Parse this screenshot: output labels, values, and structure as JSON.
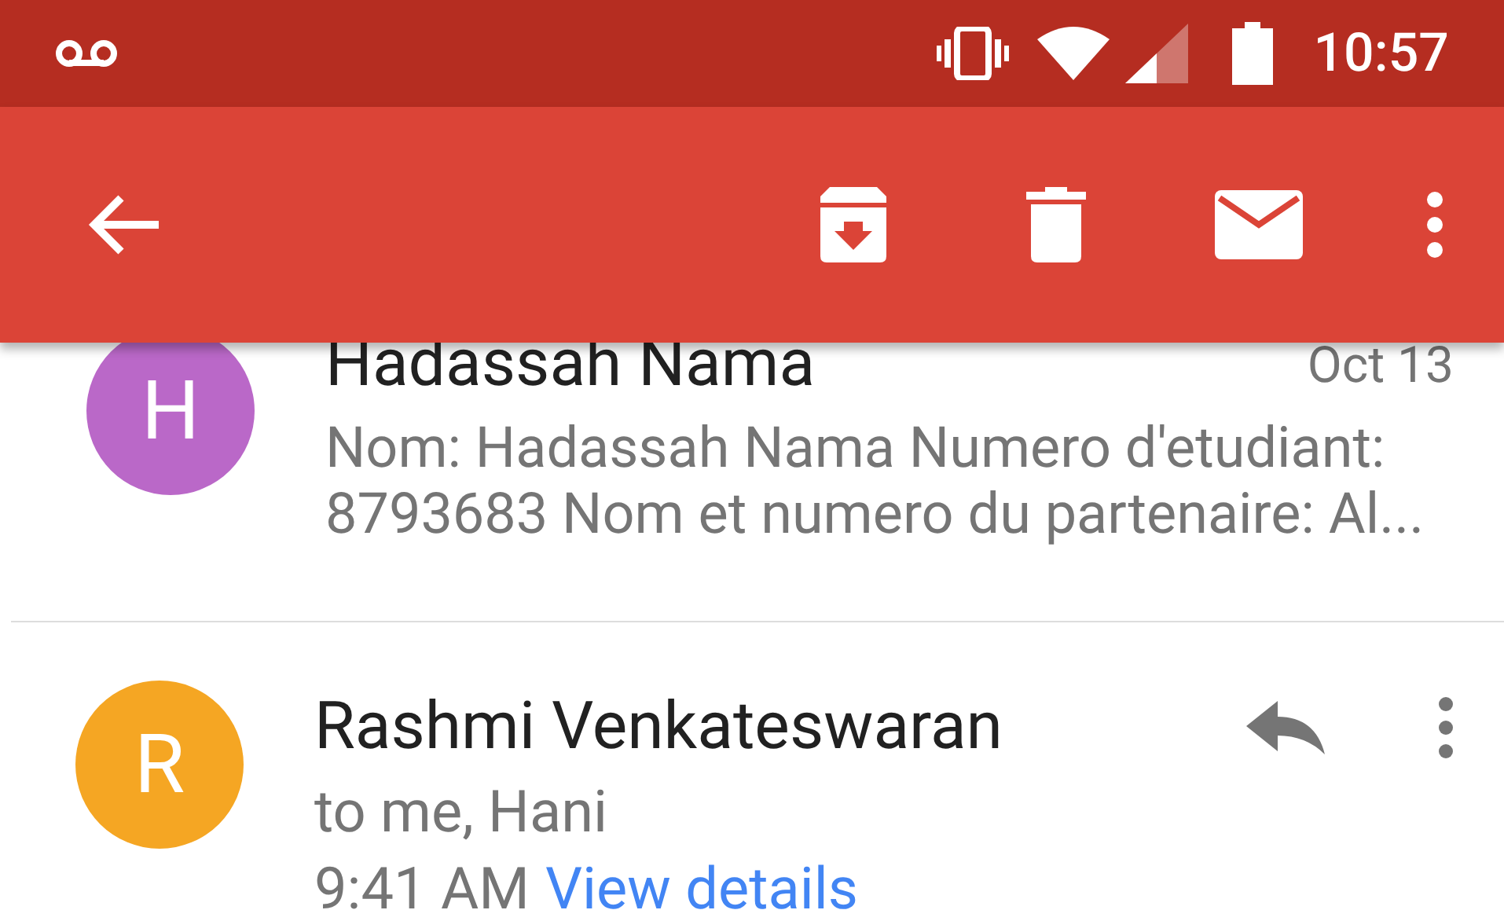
{
  "status_bar": {
    "time": "10:57"
  },
  "messages": [
    {
      "initial": "H",
      "color": "#ba68c8",
      "sender": "Hadassah Nama",
      "date": "Oct 13",
      "snippet": "Nom: Hadassah Nama Numero d'etudiant: 8793683 Nom et numero du partenaire: Al...",
      "expanded": false
    },
    {
      "initial": "R",
      "color": "#f5a623",
      "sender": "Rashmi Venkateswaran",
      "recipients": "to me, Hani",
      "time": "9:41 AM",
      "details_link": "View details",
      "expanded": true
    }
  ]
}
